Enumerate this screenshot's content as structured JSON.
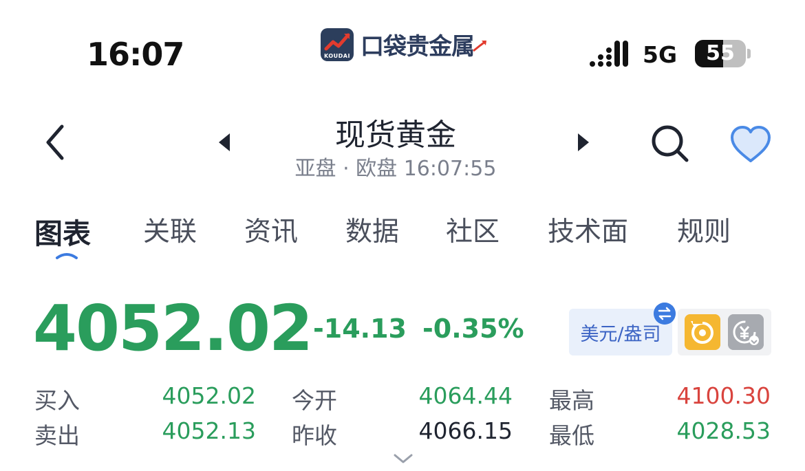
{
  "status_bar": {
    "time": "16:07",
    "network": "5G",
    "battery": "55",
    "battery_level": 0.55,
    "brand_name": "口袋贵金属",
    "brand_logo_text": "KOUDAI"
  },
  "header": {
    "title": "现货黄金",
    "subtitle": "亚盘 · 欧盘 16:07:55"
  },
  "tabs": [
    {
      "label": "图表",
      "active": true
    },
    {
      "label": "关联"
    },
    {
      "label": "资讯"
    },
    {
      "label": "数据"
    },
    {
      "label": "社区"
    },
    {
      "label": "技术面"
    },
    {
      "label": "规则"
    }
  ],
  "quote": {
    "price": "4052.02",
    "change": "-14.13",
    "change_pct": "-0.35%",
    "unit_label": "美元/盎司"
  },
  "stats": {
    "buy_label": "买入",
    "buy_value": "4052.02",
    "sell_label": "卖出",
    "sell_value": "4052.13",
    "open_label": "今开",
    "open_value": "4064.44",
    "prev_close_label": "昨收",
    "prev_close_value": "4066.15",
    "high_label": "最高",
    "high_value": "4100.30",
    "low_label": "最低",
    "low_value": "4028.53"
  },
  "colors": {
    "down": "#2a9d5c",
    "up": "#d9443e",
    "accent": "#3c64c4",
    "favorite": "#4a8ae6"
  },
  "icons": [
    "back-arrow-icon",
    "caret-left-icon",
    "caret-right-icon",
    "search-icon",
    "heart-icon",
    "swap-icon",
    "refresh-icon",
    "yen-exchange-icon",
    "chevron-down-icon"
  ]
}
